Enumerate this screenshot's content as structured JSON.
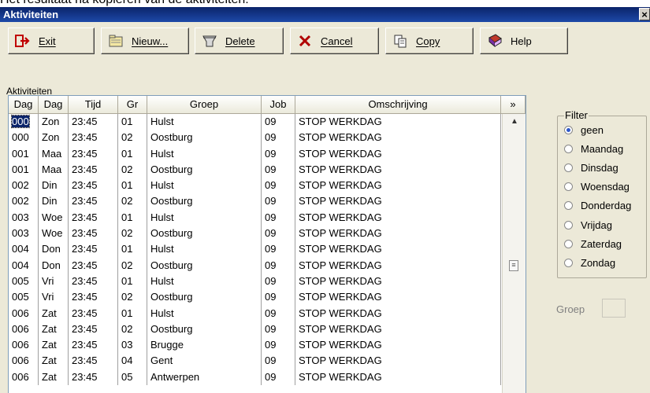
{
  "caption": "Het resultaat na kopiëren van de aktiviteiten:",
  "window": {
    "title": "Aktiviteiten",
    "close": "×"
  },
  "toolbar": {
    "buttons": [
      {
        "label": "Exit",
        "icon": "exit-arrow-icon"
      },
      {
        "label": "Nieuw...",
        "icon": "new-folder-icon"
      },
      {
        "label": "Delete",
        "icon": "trash-bin-icon"
      },
      {
        "label": "Cancel",
        "icon": "red-x-icon"
      },
      {
        "label": "Copy",
        "icon": "copy-pages-icon"
      },
      {
        "label": "Help",
        "icon": "help-book-icon"
      }
    ]
  },
  "grid": {
    "section_label": "Aktiviteiten",
    "columns": [
      "Dag",
      "Dag",
      "Tijd",
      "Gr",
      "Groep",
      "Job",
      "Omschrijving",
      "»"
    ],
    "rows": [
      [
        "000",
        "Zon",
        "23:45",
        "01",
        "Hulst",
        "09",
        "STOP WERKDAG"
      ],
      [
        "000",
        "Zon",
        "23:45",
        "02",
        "Oostburg",
        "09",
        "STOP WERKDAG"
      ],
      [
        "001",
        "Maa",
        "23:45",
        "01",
        "Hulst",
        "09",
        "STOP WERKDAG"
      ],
      [
        "001",
        "Maa",
        "23:45",
        "02",
        "Oostburg",
        "09",
        "STOP WERKDAG"
      ],
      [
        "002",
        "Din",
        "23:45",
        "01",
        "Hulst",
        "09",
        "STOP WERKDAG"
      ],
      [
        "002",
        "Din",
        "23:45",
        "02",
        "Oostburg",
        "09",
        "STOP WERKDAG"
      ],
      [
        "003",
        "Woe",
        "23:45",
        "01",
        "Hulst",
        "09",
        "STOP WERKDAG"
      ],
      [
        "003",
        "Woe",
        "23:45",
        "02",
        "Oostburg",
        "09",
        "STOP WERKDAG"
      ],
      [
        "004",
        "Don",
        "23:45",
        "01",
        "Hulst",
        "09",
        "STOP WERKDAG"
      ],
      [
        "004",
        "Don",
        "23:45",
        "02",
        "Oostburg",
        "09",
        "STOP WERKDAG"
      ],
      [
        "005",
        "Vri",
        "23:45",
        "01",
        "Hulst",
        "09",
        "STOP WERKDAG"
      ],
      [
        "005",
        "Vri",
        "23:45",
        "02",
        "Oostburg",
        "09",
        "STOP WERKDAG"
      ],
      [
        "006",
        "Zat",
        "23:45",
        "01",
        "Hulst",
        "09",
        "STOP WERKDAG"
      ],
      [
        "006",
        "Zat",
        "23:45",
        "02",
        "Oostburg",
        "09",
        "STOP WERKDAG"
      ],
      [
        "006",
        "Zat",
        "23:45",
        "03",
        "Brugge",
        "09",
        "STOP WERKDAG"
      ],
      [
        "006",
        "Zat",
        "23:45",
        "04",
        "Gent",
        "09",
        "STOP WERKDAG"
      ],
      [
        "006",
        "Zat",
        "23:45",
        "05",
        "Antwerpen",
        "09",
        "STOP WERKDAG"
      ]
    ]
  },
  "filter": {
    "legend": "Filter",
    "options": [
      "geen",
      "Maandag",
      "Dinsdag",
      "Woensdag",
      "Donderdag",
      "Vrijdag",
      "Zaterdag",
      "Zondag"
    ],
    "selected": "geen"
  },
  "groep": {
    "label": "Groep",
    "value": ""
  }
}
